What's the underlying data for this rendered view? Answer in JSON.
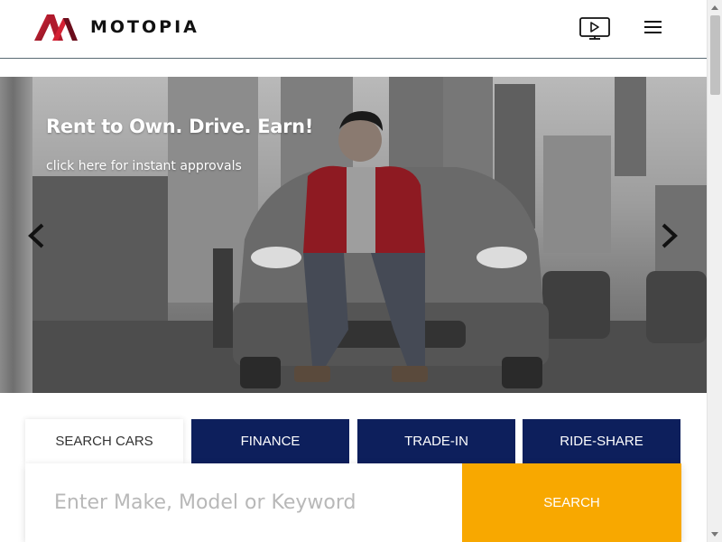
{
  "brand": {
    "name": "MOTOPIA",
    "colors": {
      "red": "#c21f2f",
      "dark_red": "#7a1020",
      "navy": "#0d1f5c",
      "orange": "#f8a800"
    }
  },
  "header": {
    "video_icon": "tv-play-icon",
    "menu_icon": "hamburger-menu-icon"
  },
  "hero": {
    "title": "Rent to Own. Drive. Earn!",
    "link_text": "click here for instant approvals",
    "prev_icon": "chevron-left-icon",
    "next_icon": "chevron-right-icon"
  },
  "tabs": [
    {
      "label": "SEARCH CARS",
      "active": true
    },
    {
      "label": "FINANCE",
      "active": false
    },
    {
      "label": "TRADE-IN",
      "active": false
    },
    {
      "label": "RIDE-SHARE",
      "active": false
    }
  ],
  "search": {
    "placeholder": "Enter Make, Model or Keyword",
    "value": "",
    "button_label": "SEARCH"
  }
}
